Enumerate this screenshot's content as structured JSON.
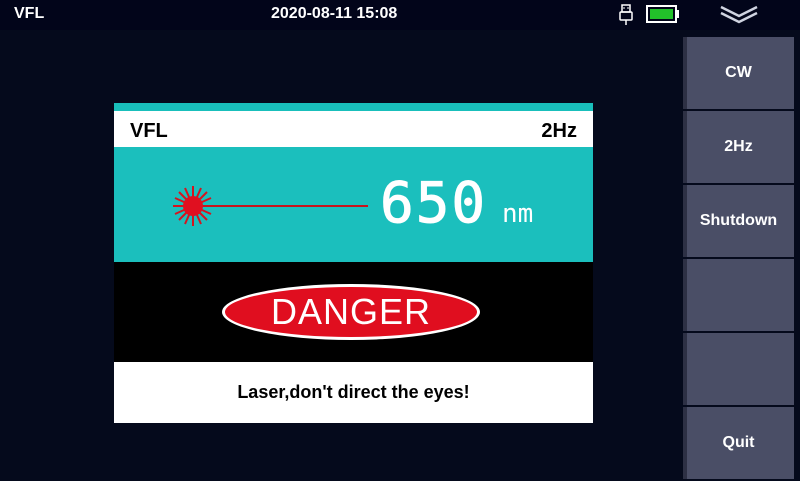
{
  "status_bar": {
    "app_title": "VFL",
    "datetime": "2020-08-11 15:08",
    "icons": [
      "usb-icon",
      "battery-icon",
      "chevron-down-icon"
    ]
  },
  "panel": {
    "mode": "VFL",
    "frequency": "2Hz",
    "wavelength_value": "650",
    "wavelength_unit": "nm",
    "danger_label": "DANGER",
    "warning_message": "Laser,don't direct the eyes!"
  },
  "sidebar": {
    "buttons": [
      {
        "label": "CW"
      },
      {
        "label": "2Hz"
      },
      {
        "label": "Shutdown"
      },
      {
        "label": ""
      },
      {
        "label": ""
      },
      {
        "label": "Quit"
      }
    ]
  },
  "colors": {
    "background": "#050a1c",
    "teal": "#1bbfbd",
    "danger_red": "#e00e1f",
    "button_gray": "#4a4e66",
    "battery_green": "#22c12a"
  }
}
